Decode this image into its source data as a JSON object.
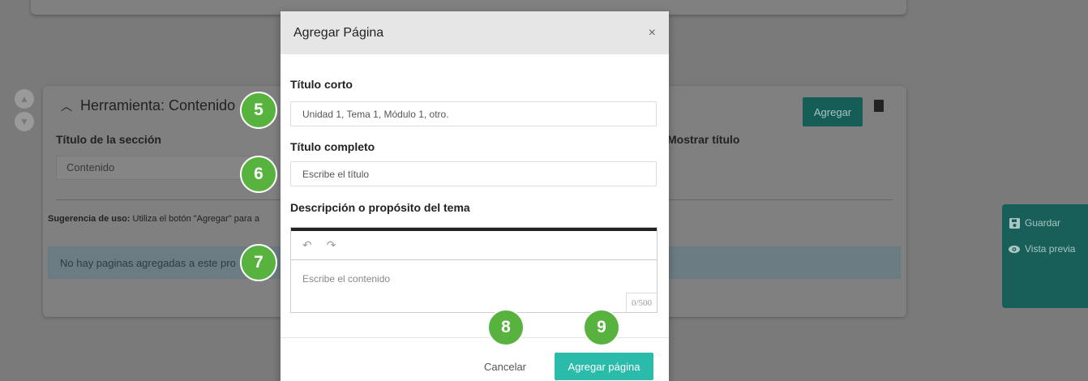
{
  "background": {
    "tool_card": {
      "heading": "Herramienta: Contenido",
      "add_button_label": "Agregar",
      "section_title_label": "Título de la sección",
      "section_title_value": "Contenido",
      "show_title_label": "Mostrar título",
      "hint_prefix": "Sugerencia de uso:",
      "hint_text": "Utiliza el botón \"Agregar\" para a",
      "empty_message": "No hay paginas agregadas a este pro"
    },
    "floating_panel": {
      "save_label": "Guardar",
      "preview_label": "Vista previa"
    }
  },
  "modal": {
    "title": "Agregar Página",
    "close_glyph": "×",
    "short_title": {
      "label": "Título corto",
      "placeholder": "Unidad 1, Tema 1, Módulo 1, otro."
    },
    "full_title": {
      "label": "Título completo",
      "placeholder": "Escribe el título"
    },
    "description": {
      "label": "Descripción o propósito del tema",
      "placeholder": "Escribe el contenido",
      "counter": "0/500",
      "undo_glyph": "↶",
      "redo_glyph": "↷"
    },
    "cancel_label": "Cancelar",
    "submit_label": "Agregar página"
  },
  "steps": [
    "5",
    "6",
    "7",
    "8",
    "9"
  ],
  "colors": {
    "accent_teal": "#2abbab",
    "step_green": "#57b33e",
    "overlay": "#7a7a7a"
  }
}
